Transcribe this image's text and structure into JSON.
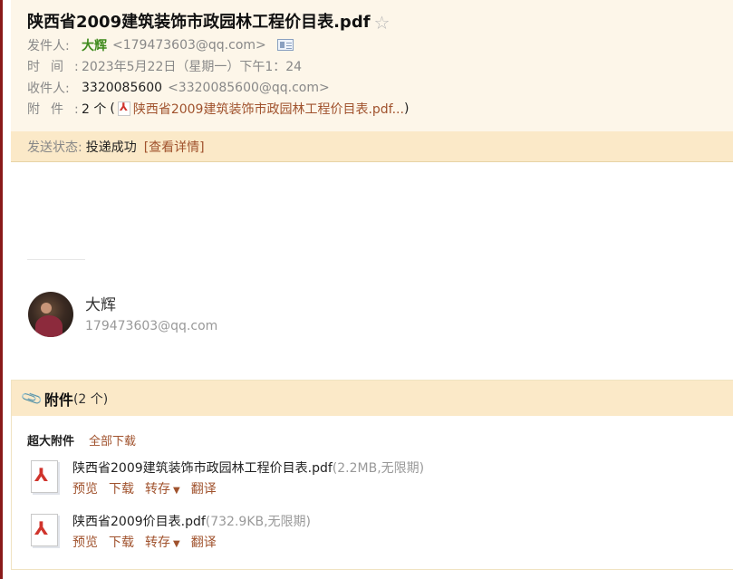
{
  "email": {
    "subject": "陕西省2009建筑装饰市政园林工程价目表.pdf",
    "labels": {
      "from": "发件人:",
      "time": "时间:",
      "to": "收件人:",
      "attach": "附件:"
    },
    "from_name": "大辉",
    "from_addr": "<179473603@qq.com>",
    "time_value": "2023年5月22日（星期一）下午1：24",
    "to_name": "3320085600",
    "to_addr": "<3320085600@qq.com>",
    "attach_count": "2 个",
    "attach_paren_open": "(",
    "attach_first": "陕西省2009建筑装饰市政园林工程价目表.pdf...",
    "attach_paren_close": ")"
  },
  "status": {
    "label": "发送状态:",
    "value": "投递成功",
    "detail": "[查看详情]"
  },
  "signature": {
    "name": "大辉",
    "email": "179473603@qq.com"
  },
  "attachments": {
    "title": "附件",
    "count": "(2 个)",
    "big_label": "超大附件",
    "download_all": "全部下载",
    "files": [
      {
        "name": "陕西省2009建筑装饰市政园林工程价目表.pdf",
        "meta": "(2.2MB,无限期)"
      },
      {
        "name": "陕西省2009价目表.pdf",
        "meta": "(732.9KB,无限期)"
      }
    ],
    "actions": {
      "preview": "预览",
      "download": "下载",
      "forward": "转存",
      "translate": "翻译"
    }
  },
  "colors": {
    "header_bg": "#fdf6e9",
    "status_bg": "#fbe9c8",
    "link": "#a0522d",
    "sender_green": "#3f8a1c",
    "pdf_red": "#d0342c"
  },
  "icons": [
    "star-icon",
    "contact-card-icon",
    "pdf-icon",
    "paperclip-icon",
    "caret-down-icon"
  ]
}
